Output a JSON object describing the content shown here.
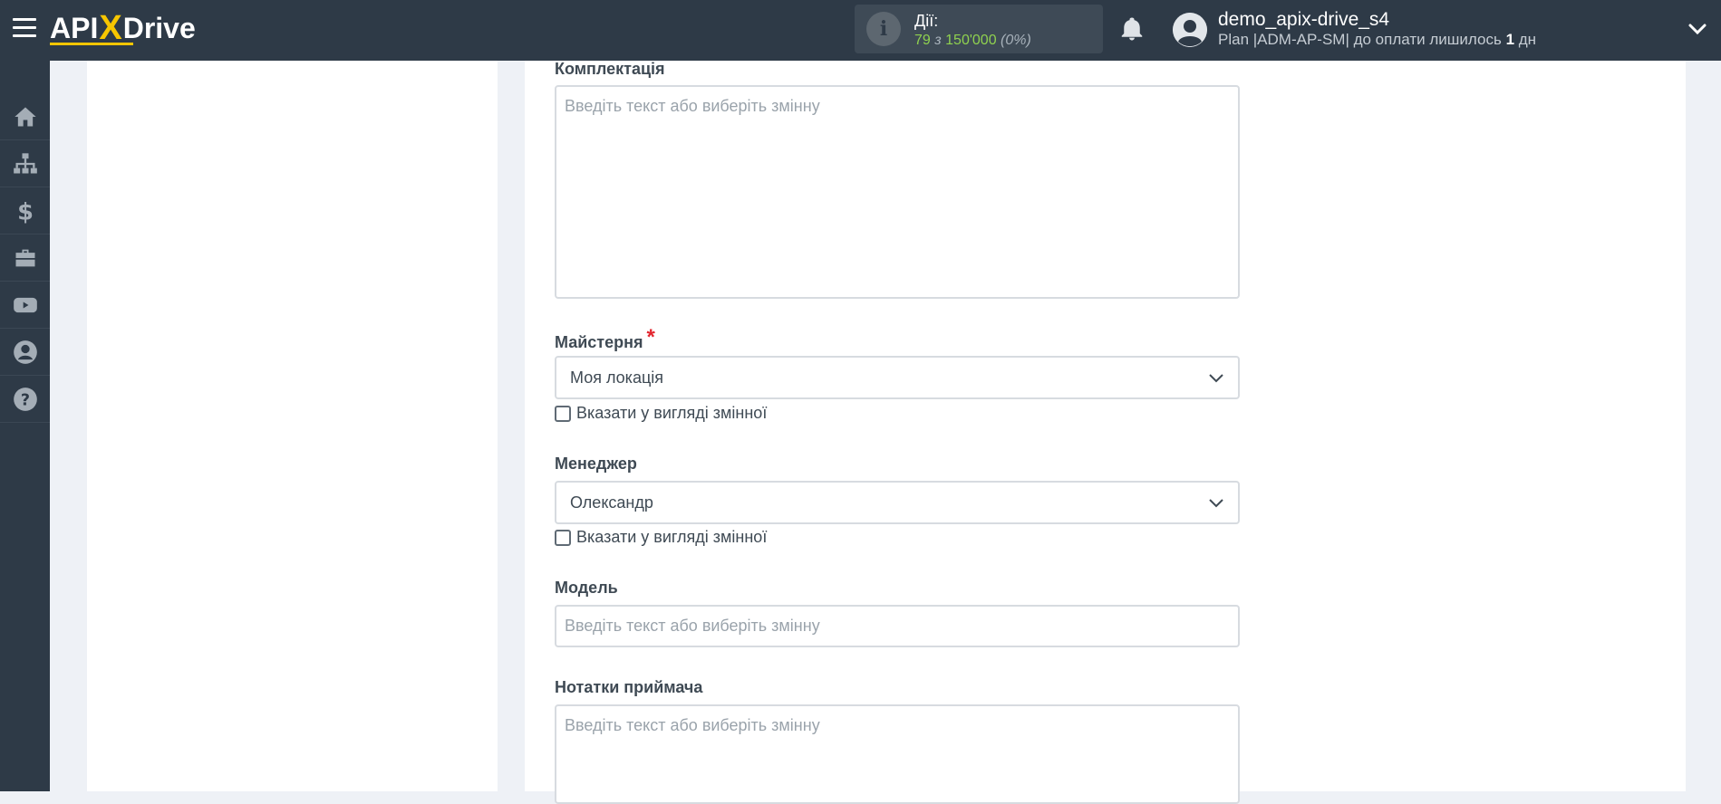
{
  "header": {
    "logo": {
      "part1": "API",
      "x": "X",
      "part2": "Drive"
    },
    "actions": {
      "label": "Дії:",
      "used": "79",
      "of": "з",
      "total": "150'000",
      "percent": "(0%)"
    },
    "user": {
      "name": "demo_apix-drive_s4",
      "plan_prefix": "Plan |ADM-AP-SM| до оплати лишилось",
      "days": "1",
      "days_suffix": "дн"
    }
  },
  "sidebar": {
    "items": [
      {
        "icon": "home-icon"
      },
      {
        "icon": "sitemap-icon"
      },
      {
        "icon": "dollar-icon"
      },
      {
        "icon": "briefcase-icon"
      },
      {
        "icon": "youtube-icon"
      },
      {
        "icon": "user-circle-icon"
      },
      {
        "icon": "question-circle-icon"
      }
    ]
  },
  "form": {
    "kit": {
      "label": "Комплектація",
      "placeholder": "Введіть текст або виберіть змінну"
    },
    "workshop": {
      "label": "Майстерня",
      "required": "*",
      "value": "Моя локація",
      "checkbox_label": "Вказати у вигляді змінної"
    },
    "manager": {
      "label": "Менеджер",
      "value": "Олександр",
      "checkbox_label": "Вказати у вигляді змінної"
    },
    "model": {
      "label": "Модель",
      "placeholder": "Введіть текст або виберіть змінну"
    },
    "receiver_notes": {
      "label": "Нотатки приймача",
      "placeholder": "Введіть текст або виберіть змінну"
    }
  },
  "colors": {
    "topbar": "#2e3a47",
    "accent": "#f7c600",
    "green": "#8fd14f",
    "required": "#e3262f"
  }
}
